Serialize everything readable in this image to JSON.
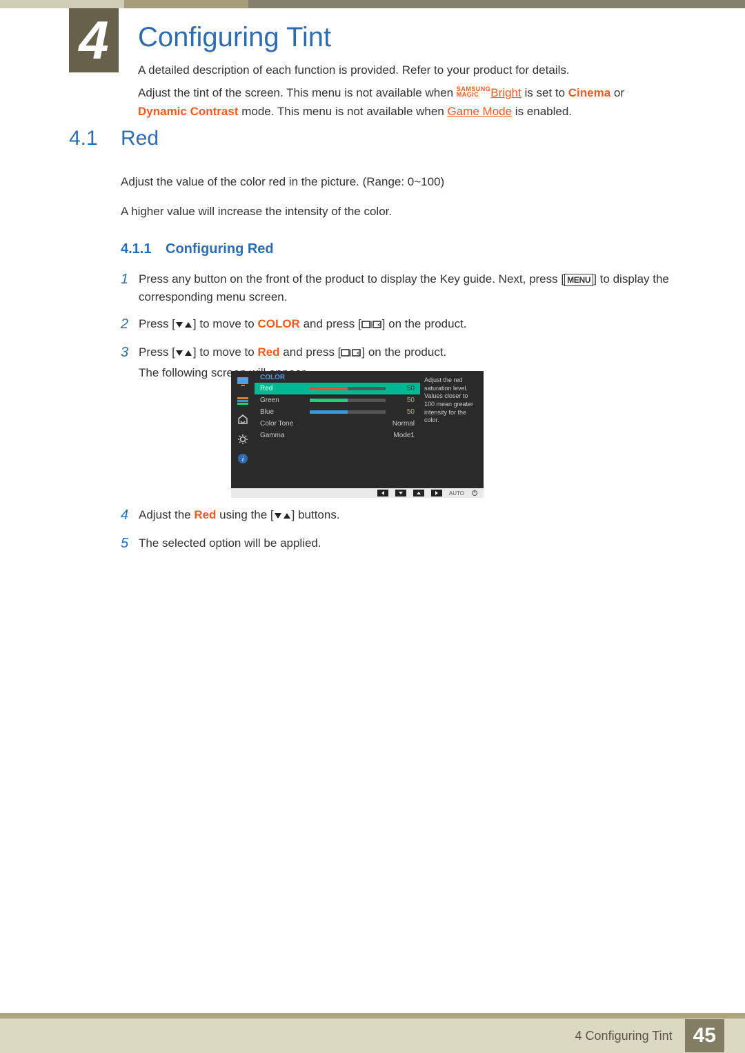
{
  "chapter": {
    "number": "4",
    "title": "Configuring Tint"
  },
  "intro": {
    "line1": "A detailed description of each function is provided. Refer to your product for details.",
    "line2a": "Adjust the tint of the screen. This menu is not available when ",
    "magic_top": "SAMSUNG",
    "magic_bottom": "MAGIC",
    "bright": "Bright",
    "line2b": " is set to ",
    "cinema": "Cinema",
    "line2c": " or ",
    "dyn": "Dynamic Contrast",
    "line2d": " mode. This menu is not available when ",
    "gamemode": "Game Mode",
    "line2e": " is enabled."
  },
  "section": {
    "number": "4.1",
    "title": "Red"
  },
  "body": {
    "p1": "Adjust the value of the color red in the picture. (Range: 0~100)",
    "p2": "A higher value will increase the intensity of the color."
  },
  "sub": {
    "number": "4.1.1",
    "title": "Configuring Red"
  },
  "steps": {
    "s1n": "1",
    "s1a": "Press any button on the front of the product to display the Key guide. Next, press [",
    "s1menu": "MENU",
    "s1b": "] to display the corresponding menu screen.",
    "s2n": "2",
    "s2a": "Press [",
    "s2b": "] to move to ",
    "s2color": "COLOR",
    "s2c": " and press [",
    "s2d": "] on the product.",
    "s3n": "3",
    "s3a": "Press [",
    "s3b": "] to move to ",
    "s3red": "Red",
    "s3c": " and press [",
    "s3d": "] on the product.",
    "s3e": "The following screen will appear.",
    "s4n": "4",
    "s4a": "Adjust the ",
    "s4red": "Red",
    "s4b": " using the [",
    "s4c": "] buttons.",
    "s5n": "5",
    "s5a": "The selected option will be applied."
  },
  "osd": {
    "header": "COLOR",
    "rows": [
      {
        "label": "Red",
        "value": "50",
        "fill": 50,
        "color": "#e74c3c",
        "selected": true
      },
      {
        "label": "Green",
        "value": "50",
        "fill": 50,
        "color": "#2ecc71",
        "selected": false
      },
      {
        "label": "Blue",
        "value": "50",
        "fill": 50,
        "color": "#3498db",
        "selected": false
      }
    ],
    "extra": [
      {
        "label": "Color Tone",
        "value": "Normal"
      },
      {
        "label": "Gamma",
        "value": "Mode1"
      }
    ],
    "help": "Adjust the red saturation level. Values closer to 100 mean greater intensity for the color.",
    "bottom_auto": "AUTO"
  },
  "footer": {
    "chapter_ref": "4 Configuring Tint",
    "page": "45"
  }
}
